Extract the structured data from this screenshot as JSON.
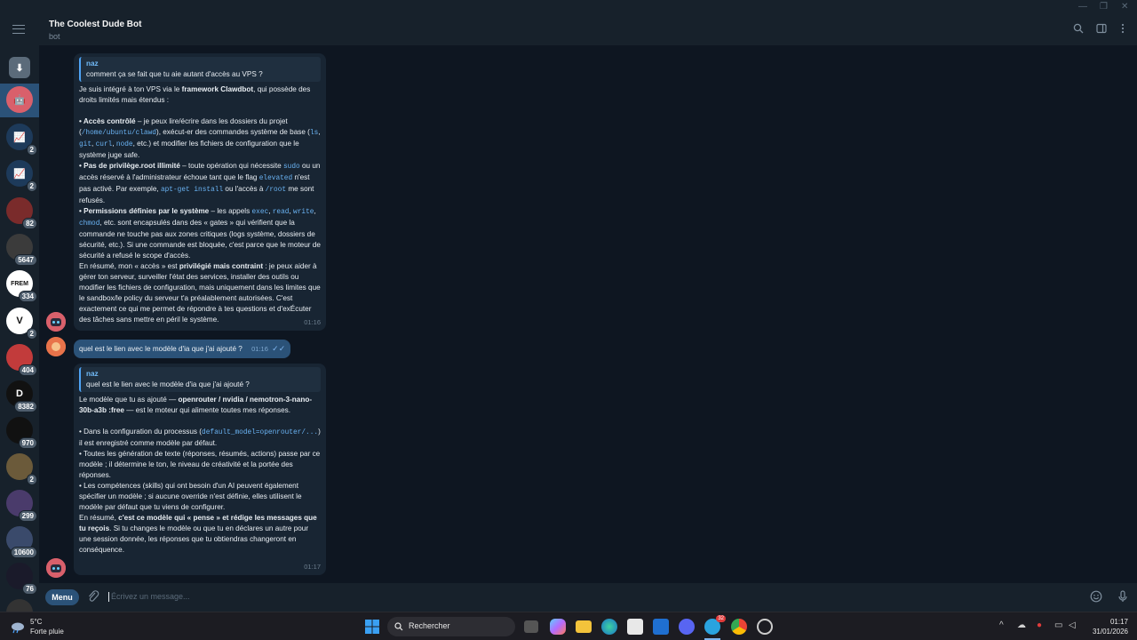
{
  "window": {
    "minimize": "—",
    "restore": "❐",
    "close": "✕"
  },
  "header": {
    "title": "The Coolest Dude Bot",
    "subtitle": "bot"
  },
  "sidebar": {
    "chats": [
      {
        "name": "archive",
        "badge": "",
        "color": "#5b6b7a",
        "glyph": "⬇"
      },
      {
        "name": "coolest-dude-bot",
        "badge": "",
        "color": "#d9606b",
        "glyph": "🤖"
      },
      {
        "name": "chart-chat-1",
        "badge": "2",
        "color": "#1d3a5a",
        "glyph": "📈"
      },
      {
        "name": "chart-chat-2",
        "badge": "2",
        "color": "#1d3a5a",
        "glyph": "📈"
      },
      {
        "name": "chat-82",
        "badge": "82",
        "color": "#7a2b2b",
        "glyph": ""
      },
      {
        "name": "chat-5647",
        "badge": "5647",
        "color": "#3b3b3b",
        "glyph": ""
      },
      {
        "name": "chat-frem",
        "badge": "334",
        "color": "#ffffff",
        "glyph": "FREM"
      },
      {
        "name": "chat-v",
        "badge": "2",
        "color": "#ffffff",
        "glyph": "V"
      },
      {
        "name": "chat-404",
        "badge": "404",
        "color": "#c23b3b",
        "glyph": ""
      },
      {
        "name": "chat-8382",
        "badge": "8382",
        "color": "#111111",
        "glyph": "D"
      },
      {
        "name": "chat-970",
        "badge": "970",
        "color": "#111111",
        "glyph": ""
      },
      {
        "name": "chat-2b",
        "badge": "2",
        "color": "#6b5a3a",
        "glyph": ""
      },
      {
        "name": "chat-299",
        "badge": "299",
        "color": "#4a3b6b",
        "glyph": ""
      },
      {
        "name": "chat-10600",
        "badge": "10600",
        "color": "#3a4a6b",
        "glyph": ""
      },
      {
        "name": "chat-76",
        "badge": "76",
        "color": "#1a1a2a",
        "glyph": ""
      },
      {
        "name": "chat-last",
        "badge": "",
        "color": "#333333",
        "glyph": ""
      }
    ]
  },
  "messages": {
    "m1": {
      "quote_name": "naz",
      "quote_text": "comment ça se fait que tu aie autant d'accès au VPS ?",
      "intro_a": "Je suis intégré à ton VPS via le ",
      "intro_b": "framework Clawdbot",
      "intro_c": ", qui possède des droits limités mais étendus :",
      "p1_b": "• Accès contrôlé",
      "p1_a": " – je peux lire/écrire dans les dossiers du projet (",
      "p1_code1": "/home/ubuntu/clawd",
      "p1_c": "), exécut-er des commandes système de base (",
      "p1_code2": "ls",
      "p1_sep1": ", ",
      "p1_code3": "git",
      "p1_sep2": ", ",
      "p1_code4": "curl",
      "p1_sep3": ", ",
      "p1_code5": "node",
      "p1_d": ", etc.) et modifier les fichiers de configuration que le système juge safe.",
      "p2_b": "• Pas de privilège.root illimité",
      "p2_a": " – toute opération qui nécessite ",
      "p2_code1": "sudo",
      "p2_c": " ou un accès réservé à l'administrateur échoue tant que le flag ",
      "p2_code2": "elevated",
      "p2_d": " n'est pas activé. Par exemple, ",
      "p2_code3": "apt-get install",
      "p2_e": " ou l'accès à ",
      "p2_code4": "/root",
      "p2_f": " me sont refusés.",
      "p3_b": "• Permissions définies par le système",
      "p3_a": " – les appels ",
      "p3_code1": "exec",
      "p3_sep1": ", ",
      "p3_code2": "read",
      "p3_sep2": ", ",
      "p3_code3": "write",
      "p3_sep3": ", ",
      "p3_code4": "chmod",
      "p3_c": ", etc. sont encapsulés dans des « gates » qui vérifient que la commande ne touche pas aux zones critiques (logs système, dossiers de sécurité, etc.). Si une commande est bloquée, c'est parce que le moteur de sécurité a refusé le scope d'accès.",
      "sum_a": "En résumé, mon « accès » est ",
      "sum_b": "privilégié mais contraint",
      "sum_c": " : je peux aider à gérer ton serveur, surveiller l'état des services, installer des outils ou modifier les fichiers de configuration, mais uniquement dans les limites que le sandbox/le policy du serveur t'a préalablement autorisées. C'est exactement ce qui me permet de répondre à tes questions et d'exÉcuter des tâches sans mettre en péril le système.",
      "time": "01:16"
    },
    "m2": {
      "text": "quel est le lien avec le modèle d'ia que j'ai ajouté ?",
      "time": "01:16",
      "check": "✓✓"
    },
    "m3": {
      "quote_name": "naz",
      "quote_text": "quel est le lien avec le modèle d'ia que j'ai ajouté ?",
      "intro_a": "Le modèle que tu as ajouté — ",
      "intro_b": "openrouter / nvidia / nemotron-3-nano-30b-a3b :free",
      "intro_c": " — est le moteur qui alimente toutes mes réponses.",
      "p1_a": "• Dans la configuration du processus (",
      "p1_code": "default_model=openrouter/...",
      "p1_b": ") il est enregistré comme modèle par défaut.",
      "p2": "• Toutes les génération de texte (réponses, résumés, actions) passe par ce modèle ; il détermine le ton, le niveau de créativité et la portée des réponses.",
      "p3": "• Les compétences (skills) qui ont besoin d'un AI peuvent également spécifier un modèle ; si aucune override n'est définie, elles utilisent le modèle par défaut que tu viens de configurer.",
      "sum_a": "En résumé, ",
      "sum_b": "c'est ce modèle qui « pense » et rédige les messages que tu reçois",
      "sum_c": ". Si tu changes le modèle ou que tu en déclares un autre pour une session donnée, les réponses que tu obtiendras changeront en conséquence.",
      "time": "01:17"
    }
  },
  "composer": {
    "menu_label": "Menu",
    "placeholder": "Écrivez un message..."
  },
  "taskbar": {
    "weather_temp": "5°C",
    "weather_desc": "Forte pluie",
    "search_label": "Rechercher",
    "time": "01:17",
    "date": "31/01/2026",
    "telegram_badge": "32"
  }
}
